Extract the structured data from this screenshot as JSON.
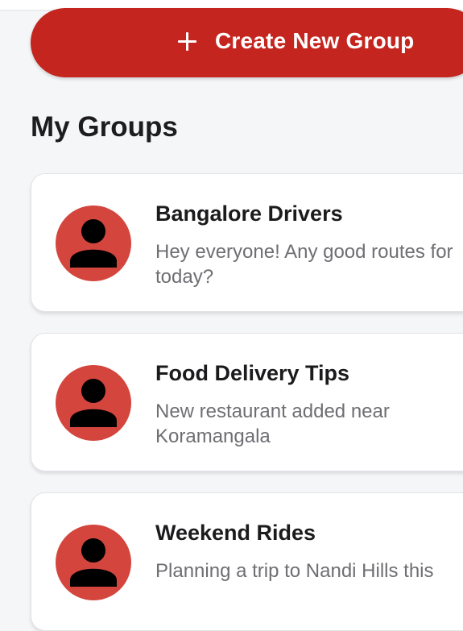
{
  "actions": {
    "create_group_label": "Create New Group"
  },
  "section": {
    "title": "My Groups"
  },
  "groups": [
    {
      "name": "Bangalore Drivers",
      "last_message": "Hey everyone! Any good routes for today?"
    },
    {
      "name": "Food Delivery Tips",
      "last_message": "New restaurant added near Koramangala"
    },
    {
      "name": "Weekend Rides",
      "last_message": "Planning a trip to Nandi Hills this"
    }
  ],
  "icons": {
    "create": "plus-icon",
    "avatar": "person-icon"
  },
  "colors": {
    "primary": "#c4261f",
    "avatar_bg": "#d3453d",
    "background": "#f5f6f8",
    "card": "#ffffff",
    "title_text": "#1b1b1d",
    "muted_text": "#6e6e73"
  }
}
